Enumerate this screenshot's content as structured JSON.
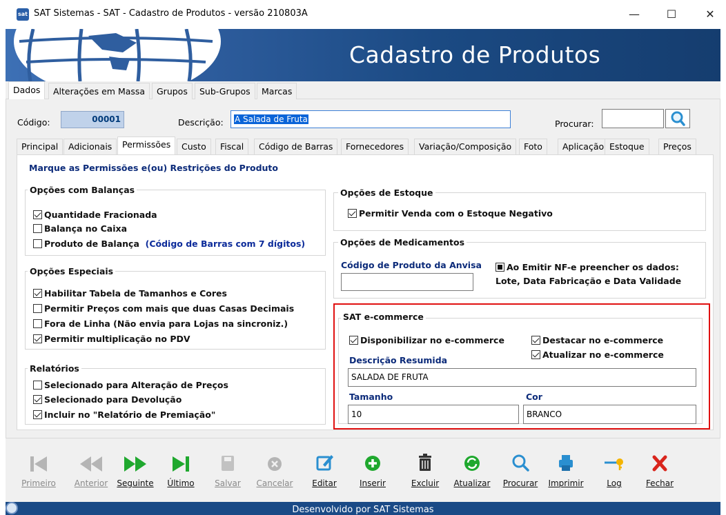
{
  "window": {
    "title": "SAT Sistemas - SAT - Cadastro de Produtos - versão 210803A",
    "app_icon_text": "sat",
    "minimize": "—",
    "maximize": "☐",
    "close": "✕"
  },
  "banner": {
    "title": "Cadastro de Produtos"
  },
  "main_tabs": [
    "Dados",
    "Alterações em Massa",
    "Grupos",
    "Sub-Grupos",
    "Marcas"
  ],
  "header_fields": {
    "codigo_label": "Código:",
    "codigo_value": "00001",
    "descricao_label": "Descrição:",
    "descricao_value": "A Salada de Fruta",
    "procurar_label": "Procurar:",
    "procurar_value": ""
  },
  "sub_tabs": [
    "Principal",
    "Adicionais",
    "Permissões",
    "Custo",
    "Fiscal",
    "Código de Barras",
    "Fornecedores",
    "Variação/Composição",
    "Foto",
    "Aplicação",
    "Estoque",
    "Preços"
  ],
  "permissions": {
    "heading": "Marque as Permissões e(ou) Restrições do Produto",
    "balancas": {
      "title": "Opções com Balanças",
      "items": [
        {
          "label": "Quantidade Fracionada",
          "checked": true
        },
        {
          "label": "Balança no Caixa",
          "checked": false
        },
        {
          "label": "Produto de Balança",
          "checked": false,
          "note": "(Código de Barras com 7 dígitos)"
        }
      ]
    },
    "especiais": {
      "title": "Opções Especiais",
      "items": [
        {
          "label": "Habilitar Tabela de Tamanhos e Cores",
          "checked": true
        },
        {
          "label": "Permitir Preços com mais que duas Casas Decimais",
          "checked": false
        },
        {
          "label": "Fora de Linha (Não envia para Lojas na sincroniz.)",
          "checked": false
        },
        {
          "label": "Permitir multiplicação no PDV",
          "checked": true
        }
      ]
    },
    "relatorios": {
      "title": "Relatórios",
      "items": [
        {
          "label": "Selecionado para Alteração de Preços",
          "checked": false
        },
        {
          "label": "Selecionado para Devolução",
          "checked": true
        },
        {
          "label": "Incluir no \"Relatório de Premiação\"",
          "checked": true
        }
      ]
    },
    "estoque": {
      "title": "Opções de Estoque",
      "items": [
        {
          "label": "Permitir Venda com o Estoque Negativo",
          "checked": true
        }
      ]
    },
    "medicamentos": {
      "title": "Opções de Medicamentos",
      "anvisa_label": "Código de Produto da Anvisa",
      "anvisa_value": "",
      "nfe_line1": "Ao Emitir NF-e preencher os dados:",
      "nfe_line2": "Lote, Data Fabricação e Data Validade"
    },
    "ecommerce": {
      "title": "SAT e-commerce",
      "disponibilizar": "Disponibilizar no e-commerce",
      "destacar": "Destacar no e-commerce",
      "atualizar": "Atualizar no e-commerce",
      "descricao_label": "Descrição Resumida",
      "descricao_value": "SALADA DE FRUTA",
      "tamanho_label": "Tamanho",
      "tamanho_value": "10",
      "cor_label": "Cor",
      "cor_value": "BRANCO"
    }
  },
  "toolbar": {
    "primeiro": "Primeiro",
    "anterior": "Anterior",
    "seguinte": "Seguinte",
    "ultimo": "Último",
    "salvar": "Salvar",
    "cancelar": "Cancelar",
    "editar": "Editar",
    "inserir": "Inserir",
    "excluir": "Excluir",
    "atualizar": "Atualizar",
    "procurar": "Procurar",
    "imprimir": "Imprimir",
    "log": "Log",
    "fechar": "Fechar"
  },
  "footer": {
    "text": "Desenvolvido por SAT Sistemas"
  },
  "colors": {
    "banner": "#1b4a83",
    "accent_red": "#e01010",
    "label_blue": "#0c2b7a",
    "green_icon": "#1fa82e"
  }
}
